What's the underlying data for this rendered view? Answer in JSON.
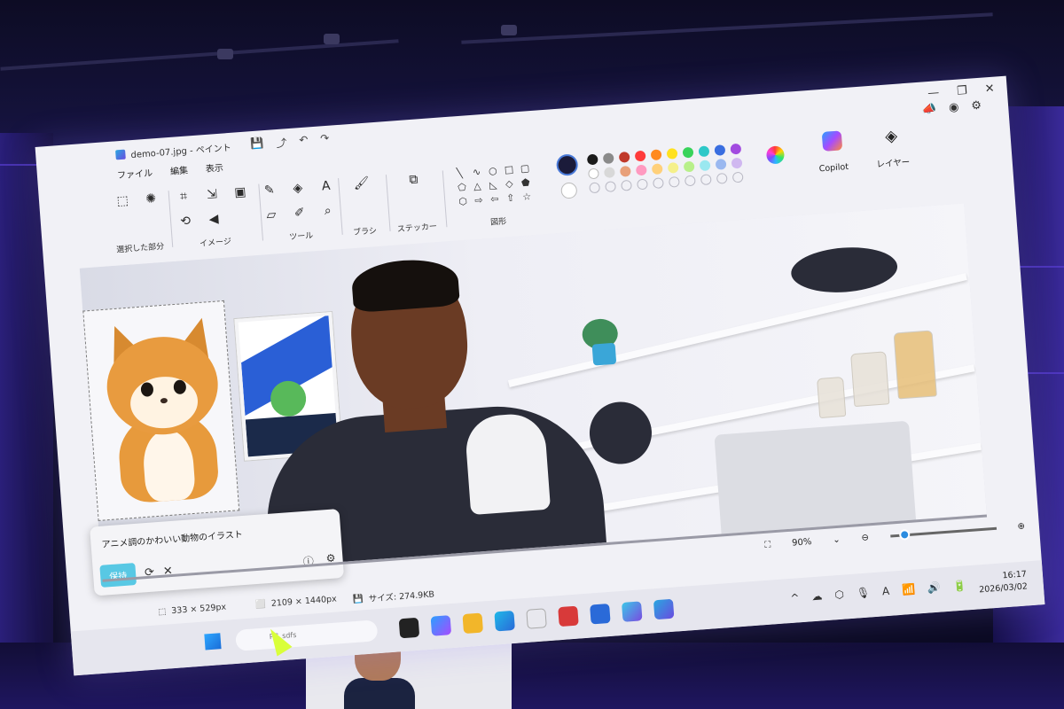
{
  "window": {
    "title": "demo-07.jpg - ペイント",
    "actions": [
      "💾",
      "⤴",
      "↶",
      "↷"
    ],
    "controls": [
      "—",
      "❐",
      "✕"
    ]
  },
  "menu": {
    "file": "ファイル",
    "edit": "編集",
    "view": "表示"
  },
  "ribbon": {
    "selection_label": "選択した部分",
    "image_label": "イメージ",
    "tools_label": "ツール",
    "text_tool": "A",
    "brush_label": "ブラシ",
    "sticker_label": "ステッカー",
    "shapes_label": "図形",
    "copilot_label": "Copilot",
    "layers_label": "レイヤー"
  },
  "palette": {
    "primary": "#1b1b3a",
    "secondary": "#ffffff",
    "colors": [
      "#1a1a1a",
      "#8a8a8a",
      "#c0392b",
      "#ff3b3b",
      "#ff8a1f",
      "#ffe11f",
      "#38d35a",
      "#2ec8c8",
      "#3a6ee0",
      "#a24be0",
      "#ffffff",
      "#d8d8d8",
      "#e8a07a",
      "#ff9ac0",
      "#ffd07a",
      "#f5f08a",
      "#b8f08a",
      "#9ae8f0",
      "#9ab8f0",
      "#d0b8f0"
    ]
  },
  "prompt": {
    "text": "アニメ調のかわいい動物のイラスト",
    "keep_button": "保持",
    "retry": "⟳",
    "discard": "✕",
    "info": "ⓘ",
    "more": "⚙"
  },
  "zoom": {
    "fit": "⛶",
    "percent": "90%",
    "dropdown": "⌄",
    "zoom_out": "⊖",
    "zoom_in": "⊕",
    "level": 0.1
  },
  "status": {
    "selection_size": "333 × 529px",
    "image_size": "2109 × 1440px",
    "file_size": "サイズ: 274.9KB"
  },
  "taskbar": {
    "search_placeholder": "PC_sdfs",
    "tray_icons": [
      "^",
      "☁",
      "⬡",
      "🎙",
      "A",
      "📶",
      "🔊",
      "🔋"
    ],
    "time": "16:17",
    "date": "2026/03/02"
  }
}
